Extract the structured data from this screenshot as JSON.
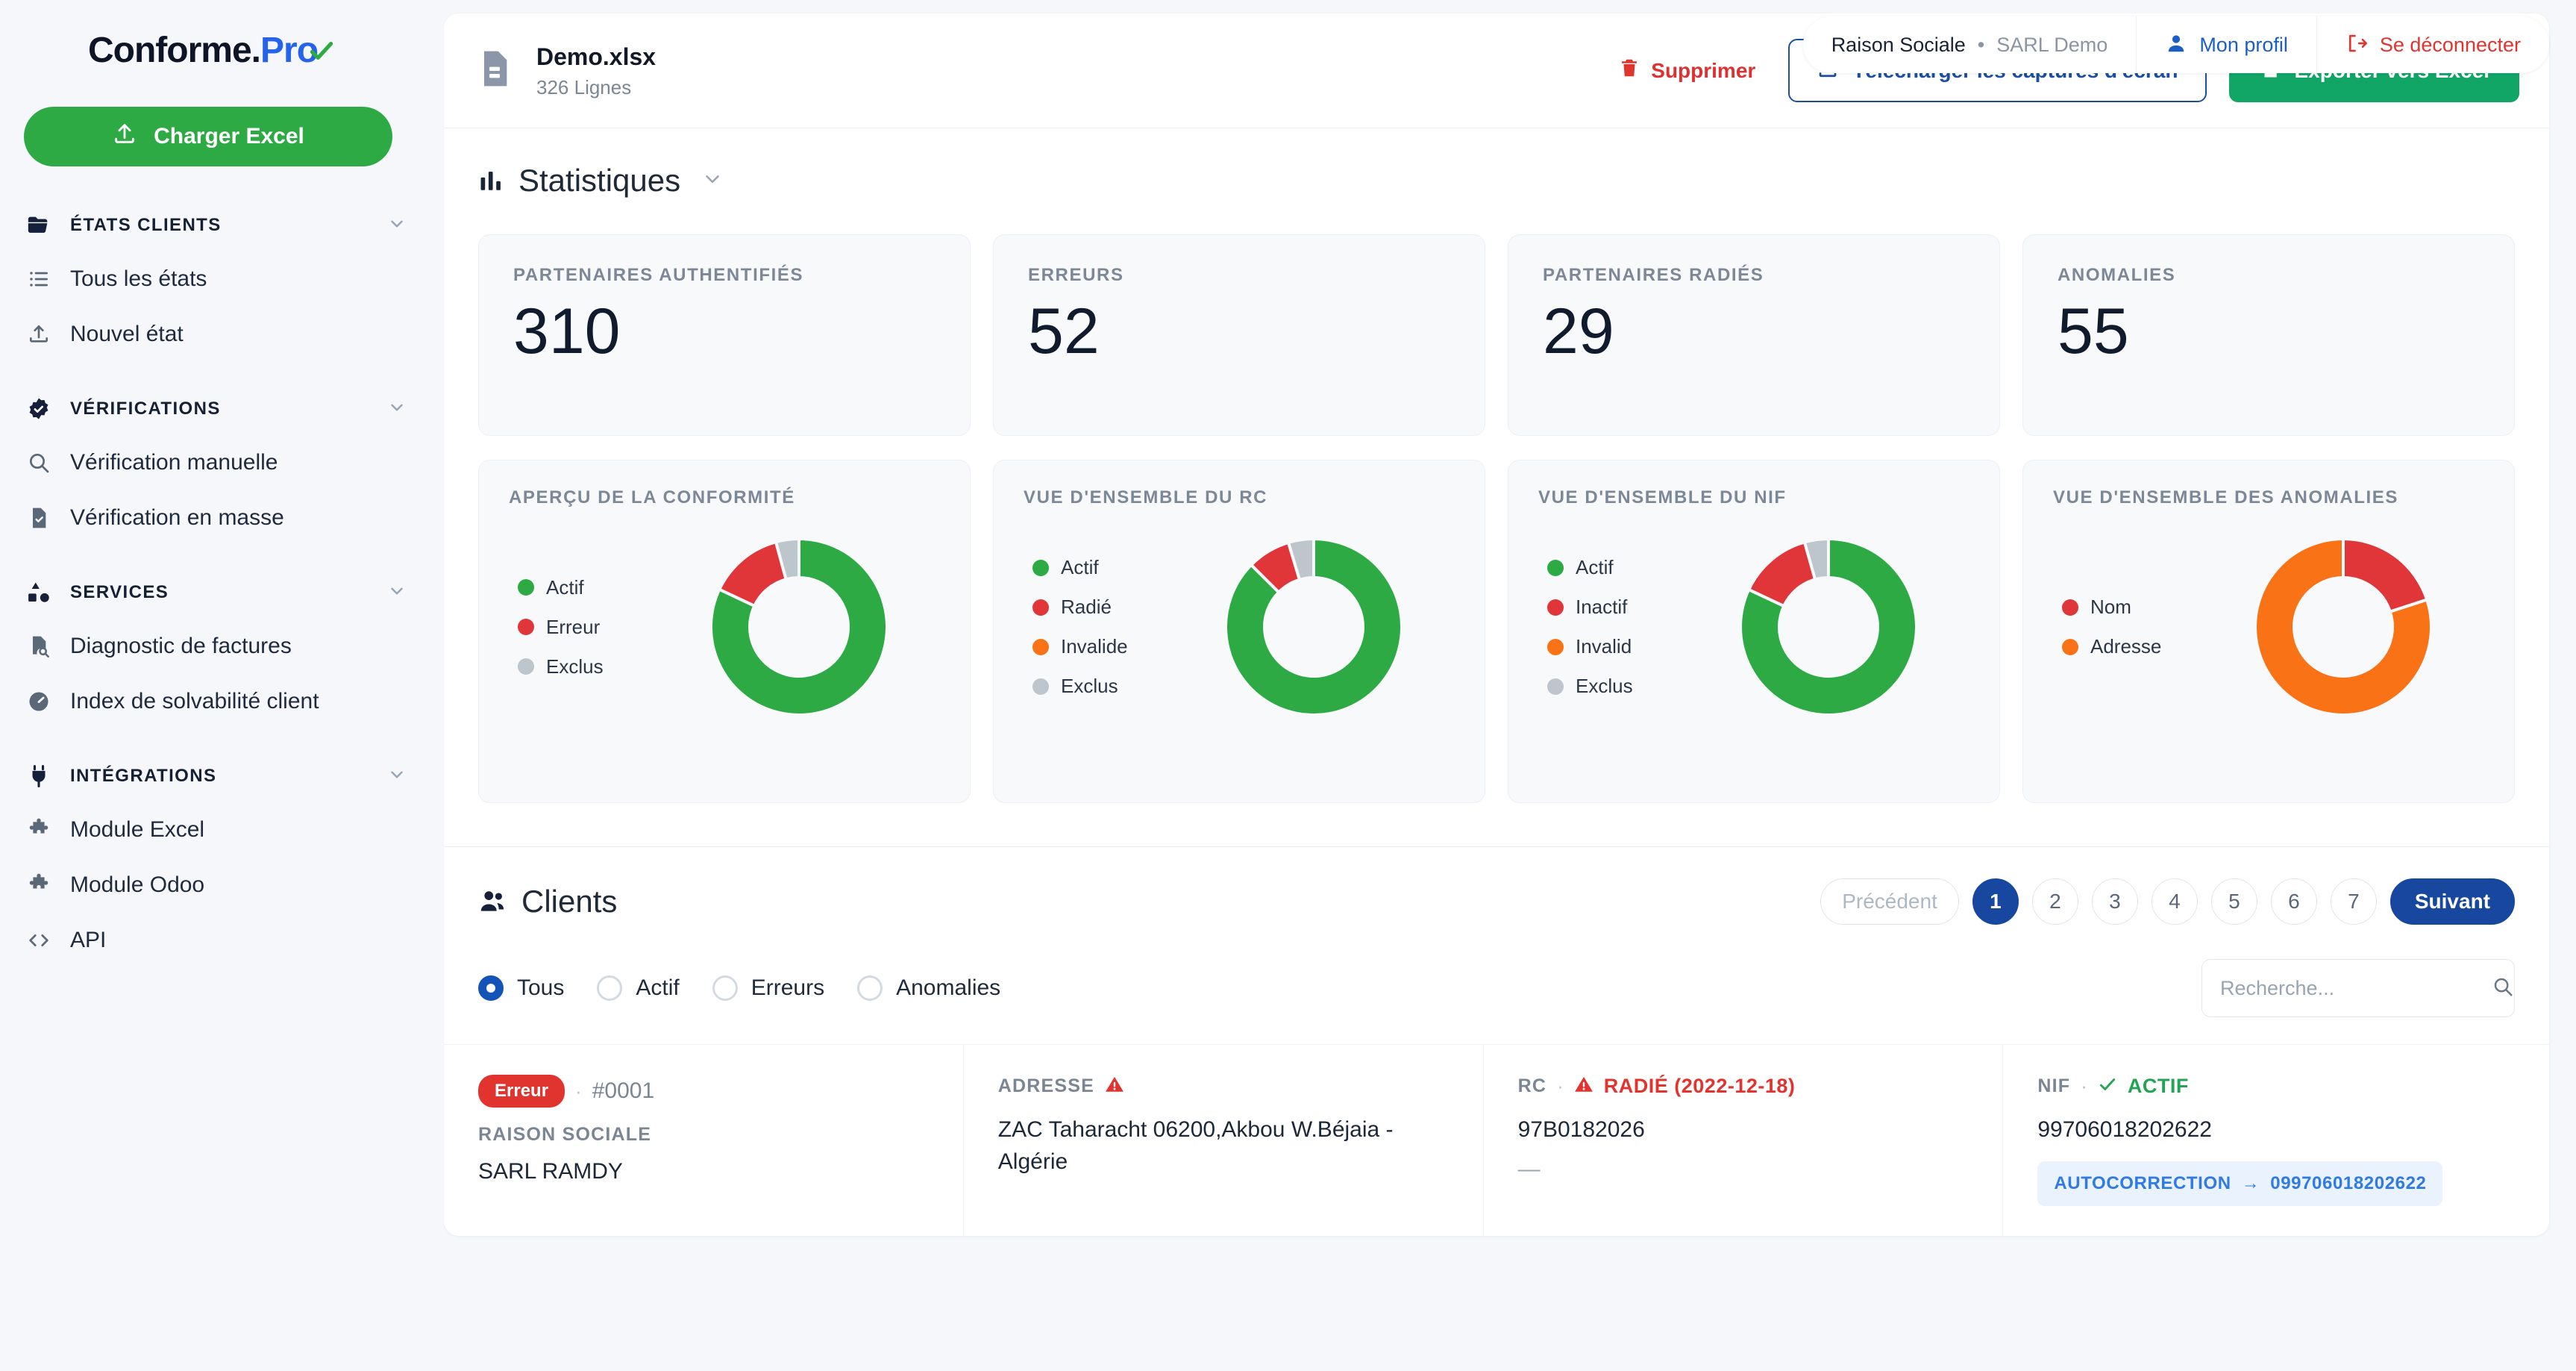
{
  "brand": {
    "part1": "Conforme.",
    "part2": "Pro"
  },
  "sidebar": {
    "upload_button": "Charger Excel",
    "groups": [
      {
        "label": "ÉTATS CLIENTS",
        "icon": "folder-icon",
        "items": [
          {
            "label": "Tous les états",
            "icon": "list-icon"
          },
          {
            "label": "Nouvel état",
            "icon": "upload-icon"
          }
        ]
      },
      {
        "label": "VÉRIFICATIONS",
        "icon": "verified-badge-icon",
        "items": [
          {
            "label": "Vérification manuelle",
            "icon": "search-icon"
          },
          {
            "label": "Vérification en masse",
            "icon": "file-check-icon"
          }
        ]
      },
      {
        "label": "SERVICES",
        "icon": "shapes-icon",
        "items": [
          {
            "label": "Diagnostic de factures",
            "icon": "file-search-icon"
          },
          {
            "label": "Index de solvabilité client",
            "icon": "gauge-icon"
          }
        ]
      },
      {
        "label": "INTÉGRATIONS",
        "icon": "plug-icon",
        "items": [
          {
            "label": "Module Excel",
            "icon": "puzzle-icon"
          },
          {
            "label": "Module Odoo",
            "icon": "puzzle-icon"
          },
          {
            "label": "API",
            "icon": "code-icon"
          }
        ]
      }
    ]
  },
  "topbar": {
    "company_label": "Raison Sociale",
    "company_separator": "•",
    "company_name": "SARL Demo",
    "profile_label": "Mon profil",
    "logout_label": "Se déconnecter"
  },
  "file": {
    "name": "Demo.xlsx",
    "rows": "326 Lignes",
    "delete_label": "Supprimer",
    "download_label": "Télécharger les captures d'écran",
    "export_label": "Exporter vers Excel"
  },
  "stats": {
    "section_title": "Statistiques",
    "kpis": [
      {
        "label": "PARTENAIRES AUTHENTIFIÉS",
        "value": "310"
      },
      {
        "label": "ERREURS",
        "value": "52"
      },
      {
        "label": "PARTENAIRES RADIÉS",
        "value": "29"
      },
      {
        "label": "ANOMALIES",
        "value": "55"
      }
    ]
  },
  "chart_data": [
    {
      "type": "pie",
      "title": "APERÇU DE LA CONFORMITÉ",
      "categories": [
        "Actif",
        "Erreur",
        "Exclus"
      ],
      "values": [
        310,
        52,
        16
      ],
      "colors": [
        "#2eaa44",
        "#e0363a",
        "#bdc5cd"
      ],
      "legend_position": "left",
      "donut": true
    },
    {
      "type": "pie",
      "title": "VUE D'ENSEMBLE DU RC",
      "categories": [
        "Actif",
        "Radié",
        "Invalide",
        "Exclus"
      ],
      "values": [
        320,
        29,
        0,
        17
      ],
      "colors": [
        "#2eaa44",
        "#e0363a",
        "#f97316",
        "#bdc5cd"
      ],
      "legend_position": "left",
      "donut": true
    },
    {
      "type": "pie",
      "title": "VUE D'ENSEMBLE DU NIF",
      "categories": [
        "Actif",
        "Inactif",
        "Invalid",
        "Exclus"
      ],
      "values": [
        300,
        50,
        0,
        16
      ],
      "colors": [
        "#2eaa44",
        "#e0363a",
        "#f97316",
        "#bdc5cd"
      ],
      "legend_position": "left",
      "donut": true
    },
    {
      "type": "pie",
      "title": "VUE D'ENSEMBLE DES ANOMALIES",
      "categories": [
        "Nom",
        "Adresse"
      ],
      "values": [
        11,
        44
      ],
      "colors": [
        "#e0363a",
        "#f97316"
      ],
      "legend_position": "left",
      "donut": true
    }
  ],
  "clients": {
    "section_title": "Clients",
    "pagination": {
      "prev_label": "Précédent",
      "next_label": "Suivant",
      "pages": [
        "1",
        "2",
        "3",
        "4",
        "5",
        "6",
        "7"
      ],
      "active_page": "1"
    },
    "filters": [
      {
        "label": "Tous",
        "selected": true
      },
      {
        "label": "Actif",
        "selected": false
      },
      {
        "label": "Erreurs",
        "selected": false
      },
      {
        "label": "Anomalies",
        "selected": false
      }
    ],
    "search_placeholder": "Recherche...",
    "search_value": "",
    "rows": [
      {
        "status_badge": "Erreur",
        "separator": "·",
        "row_id": "#0001",
        "raison_sociale_label": "RAISON SOCIALE",
        "raison_sociale_value": "SARL RAMDY",
        "adresse_label": "ADRESSE",
        "adresse_value": "ZAC Taharacht 06200,Akbou W.Béjaia - Algérie",
        "rc_label": "RC",
        "rc_status": "RADIÉ (2022-12-18)",
        "rc_value": "97B0182026",
        "rc_extra": "—",
        "nif_label": "NIF",
        "nif_status": "ACTIF",
        "nif_value": "99706018202622",
        "nif_autocorrection_label": "AUTOCORRECTION",
        "nif_autocorrection_arrow": "→",
        "nif_autocorrection_value": "099706018202622"
      }
    ]
  }
}
